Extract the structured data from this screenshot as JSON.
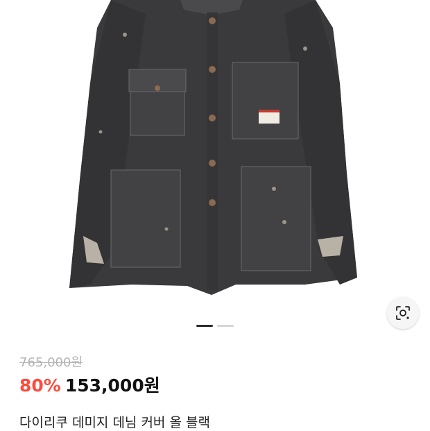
{
  "colors": {
    "discount": "#ff4a3d",
    "strike_price": "#b3b3b3",
    "price": "#111111",
    "denim": "#3a3a3c"
  },
  "gallery": {
    "image_subject": "black distressed denim coverall jacket",
    "lens_icon": "lens-search-icon",
    "pager_count": 2,
    "pager_active_index": 0
  },
  "product": {
    "original_price": "765,000원",
    "discount": "80%",
    "sale_price": "153,000원",
    "title": "다이리쿠 데미지 데님 커버 올 블랙"
  }
}
